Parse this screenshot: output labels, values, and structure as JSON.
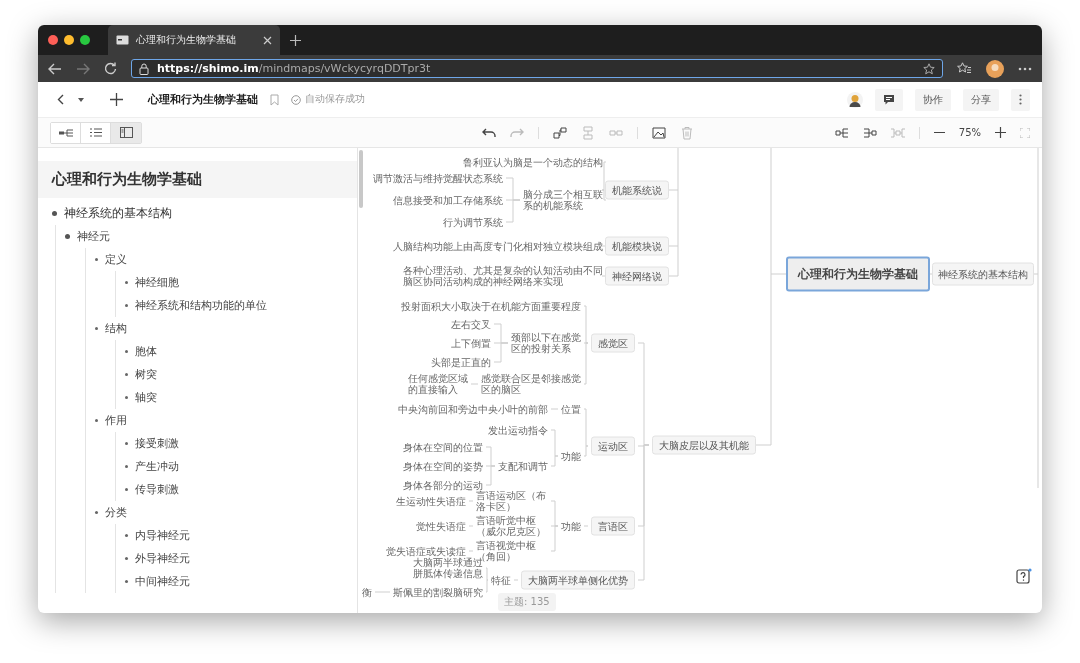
{
  "browser": {
    "tab_title": "心理和行为生物学基础",
    "url": "**https://shimo.im**/mindmaps/vWckycyrqDDTpr3t"
  },
  "header": {
    "title": "心理和行为生物学基础",
    "save_status": "自动保存成功",
    "buttons": [
      "协作",
      "分享"
    ]
  },
  "toolbar": {
    "views": [
      {
        "kind": "mindmap",
        "selected": false
      },
      {
        "kind": "list",
        "selected": false
      },
      {
        "kind": "outline",
        "selected": true
      }
    ],
    "tools": [
      {
        "kind": "undo",
        "disabled": false
      },
      {
        "kind": "redo",
        "disabled": true
      },
      {
        "kind": "add-child",
        "disabled": false
      },
      {
        "kind": "add-sibling",
        "disabled": true
      },
      {
        "kind": "link",
        "disabled": true
      },
      {
        "kind": "image",
        "disabled": false
      },
      {
        "kind": "delete",
        "disabled": true
      }
    ],
    "layouts": [
      {
        "kind": "layout-right",
        "disabled": false
      },
      {
        "kind": "layout-left",
        "disabled": false
      },
      {
        "kind": "layout-both",
        "disabled": true
      }
    ],
    "zoom": "75%"
  },
  "outline": {
    "title": "心理和行为生物学基础",
    "items": [
      {
        "label": "神经系统的基本结构",
        "children": [
          {
            "label": "神经元",
            "children": [
              {
                "label": "定义",
                "children": [
                  {
                    "label": "神经细胞"
                  },
                  {
                    "label": "神经系统和结构功能的单位"
                  }
                ]
              },
              {
                "label": "结构",
                "children": [
                  {
                    "label": "胞体"
                  },
                  {
                    "label": "树突"
                  },
                  {
                    "label": "轴突"
                  }
                ]
              },
              {
                "label": "作用",
                "children": [
                  {
                    "label": "接受刺激"
                  },
                  {
                    "label": "产生冲动"
                  },
                  {
                    "label": "传导刺激"
                  }
                ]
              },
              {
                "label": "分类",
                "children": [
                  {
                    "label": "内导神经元"
                  },
                  {
                    "label": "外导神经元"
                  },
                  {
                    "label": "中间神经元"
                  }
                ]
              }
            ]
          }
        ]
      }
    ]
  },
  "mindmap": {
    "root": "心理和行为生物学基础",
    "right": [
      {
        "kind": "box",
        "label": "神经系统的基本结构"
      }
    ],
    "partial": [
      {
        "kind": "box",
        "label": "机能系统说",
        "children": [
          {
            "kind": "text",
            "label": "鲁利亚认为脑是一个动态的结构"
          },
          {
            "kind": "text",
            "label": "脑分成三个相互联系的机能系统",
            "children": [
              {
                "kind": "text",
                "label": "调节激活与维持觉醒状态系统"
              },
              {
                "kind": "text",
                "label": "信息接受和加工存储系统"
              },
              {
                "kind": "text",
                "label": "行为调节系统"
              }
            ]
          }
        ]
      },
      {
        "kind": "box",
        "label": "机能模块说",
        "children": [
          {
            "kind": "text",
            "label": "人脑结构功能上由高度专门化相对独立模块组成"
          }
        ]
      },
      {
        "kind": "box",
        "label": "神经网络说",
        "children": [
          {
            "kind": "text",
            "label": "各种心理活动、尤其是复杂的认知活动由不同脑区协同活动构成的神经网络来实现"
          }
        ]
      }
    ],
    "left": [
      {
        "kind": "box",
        "label": "大脑皮层以及其机能",
        "children": [
          {
            "kind": "box",
            "label": "感觉区",
            "children": [
              {
                "kind": "text",
                "label": "投射面积大小取决于在机能方面重要程度"
              },
              {
                "kind": "text",
                "label": "颈部以下在感觉区的投射关系",
                "children": [
                  {
                    "kind": "text",
                    "label": "左右交叉"
                  },
                  {
                    "kind": "text",
                    "label": "上下倒置"
                  },
                  {
                    "kind": "text",
                    "label": "头部是正直的"
                  }
                ]
              },
              {
                "kind": "text",
                "label": "感觉联合区是邻接感觉区的脑区",
                "children": [
                  {
                    "kind": "text",
                    "label": "任何感觉区域的直接输入"
                  }
                ]
              }
            ]
          },
          {
            "kind": "box",
            "label": "运动区",
            "children": [
              {
                "kind": "text",
                "label": "位置",
                "children": [
                  {
                    "kind": "text",
                    "label": "中央沟前回和旁边中央小叶的前部"
                  }
                ]
              },
              {
                "kind": "text",
                "label": "功能",
                "children": [
                  {
                    "kind": "text",
                    "label": "发出运动指令"
                  },
                  {
                    "kind": "text",
                    "label": "支配和调节",
                    "children": [
                      {
                        "kind": "text",
                        "label": "身体在空间的位置"
                      },
                      {
                        "kind": "text",
                        "label": "身体在空间的姿势"
                      },
                      {
                        "kind": "text",
                        "label": "身体各部分的运动"
                      }
                    ]
                  }
                ]
              }
            ]
          },
          {
            "kind": "box",
            "label": "言语区",
            "children": [
              {
                "kind": "text",
                "label": "功能",
                "children": [
                  {
                    "kind": "text",
                    "label": "言语运动区（布洛卡区）",
                    "children": [
                      {
                        "kind": "text",
                        "label": "生运动性失语症"
                      }
                    ]
                  },
                  {
                    "kind": "text",
                    "label": "言语听觉中枢（威尔尼克区）",
                    "children": [
                      {
                        "kind": "text",
                        "label": "觉性失语症"
                      }
                    ]
                  },
                  {
                    "kind": "text",
                    "label": "言语视觉中枢（角回）",
                    "children": [
                      {
                        "kind": "text",
                        "label": "觉失语症或失读症"
                      }
                    ]
                  }
                ]
              }
            ]
          },
          {
            "kind": "box",
            "label": "大脑两半球单侧化优势",
            "children": [
              {
                "kind": "text",
                "label": "特征",
                "children": [
                  {
                    "kind": "text",
                    "label": "大脑两半球通过胼胝体传递信息"
                  },
                  {
                    "kind": "text",
                    "label": "斯佩里的割裂脑研究",
                    "children": [
                      {
                        "kind": "text",
                        "label": "衡"
                      }
                    ]
                  }
                ]
              }
            ]
          }
        ]
      }
    ]
  },
  "topic_count": "主题: 135"
}
